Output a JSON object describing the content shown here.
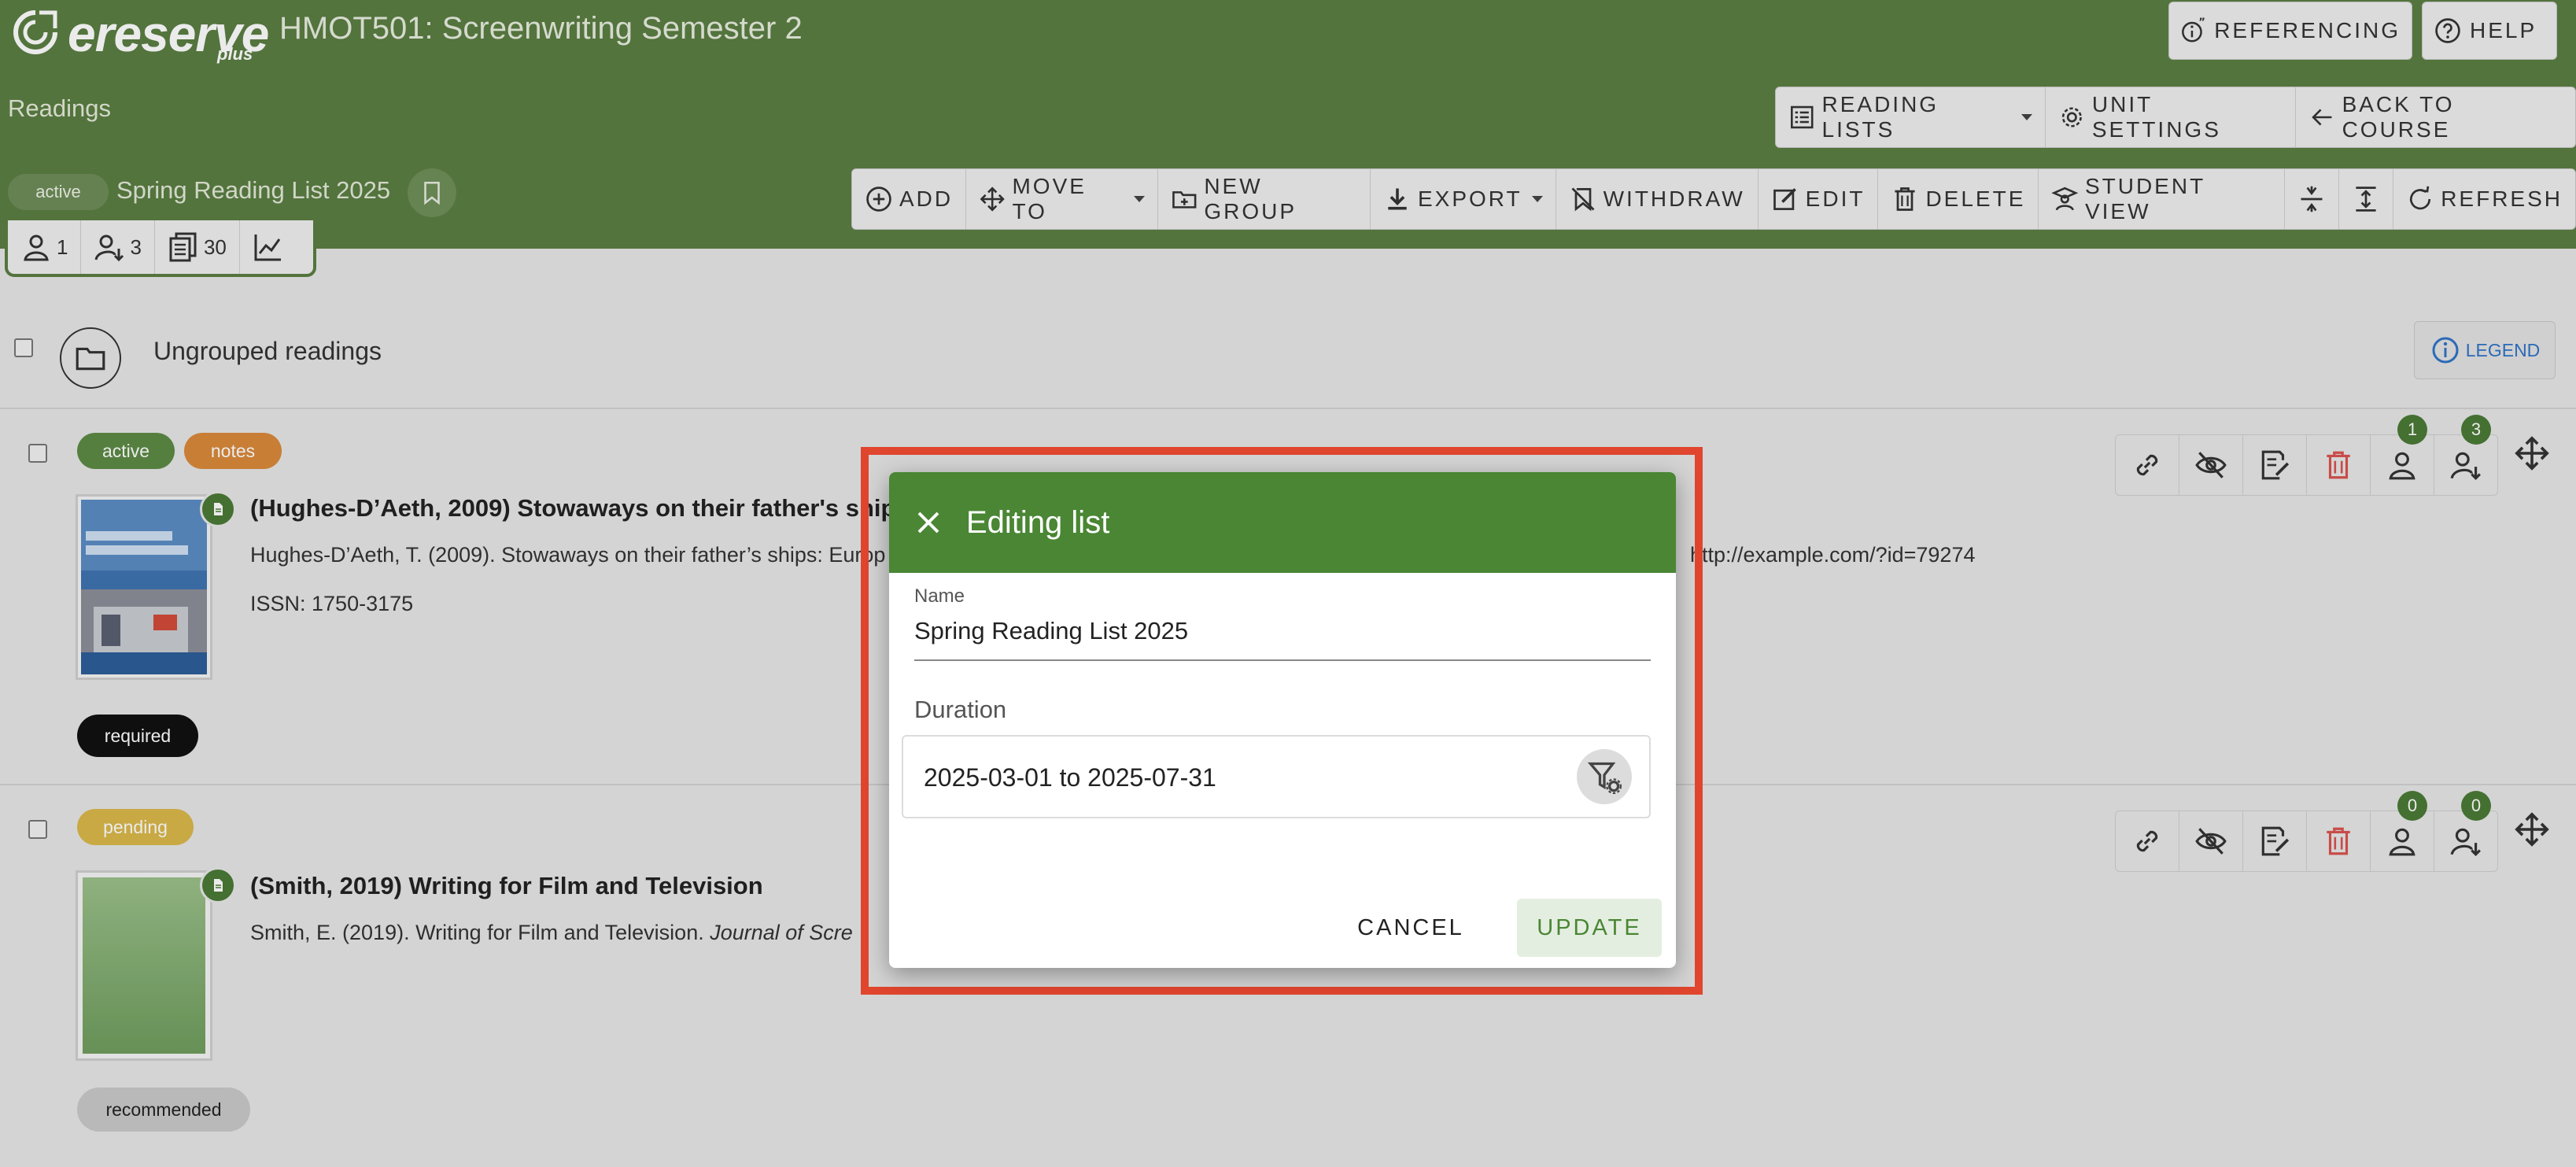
{
  "header": {
    "logo_text": "ereserve",
    "logo_sub": "plus",
    "course_title": "HMOT501: Screenwriting Semester 2",
    "section_label": "Readings",
    "referencing_label": "REFERENCING",
    "help_label": "HELP",
    "reading_lists_label": "READING LISTS",
    "unit_settings_label": "UNIT SETTINGS",
    "back_to_course_label": "BACK TO COURSE"
  },
  "toolbar": {
    "add": "ADD",
    "move_to": "MOVE TO",
    "new_group": "NEW GROUP",
    "export": "EXPORT",
    "withdraw": "WITHDRAW",
    "edit": "EDIT",
    "delete": "DELETE",
    "student_view": "STUDENT VIEW",
    "refresh": "REFRESH"
  },
  "list": {
    "status": "active",
    "name": "Spring Reading List 2025",
    "stats": {
      "users": "1",
      "enrolled": "3",
      "readings": "30"
    }
  },
  "group": {
    "title": "Ungrouped readings",
    "legend_label": "LEGEND"
  },
  "readings": [
    {
      "tags": [
        "active",
        "notes"
      ],
      "title": "(Hughes-D’Aeth, 2009) Stowaways on their father's ships",
      "citation_start": "Hughes-D’Aeth, T. (2009). Stowaways on their father’s ships: Europ",
      "citation_end": "http://example.com/?id=79274",
      "issn": "ISSN: 1750-3175",
      "requirement": "required",
      "count_users": "1",
      "count_enrolled": "3"
    },
    {
      "tags": [
        "pending"
      ],
      "title": "(Smith, 2019) Writing for Film and Television",
      "citation_start": "Smith, E. (2019). Writing for Film and Television. ",
      "citation_italic": "Journal of Scre",
      "requirement": "recommended",
      "count_users": "0",
      "count_enrolled": "0"
    }
  ],
  "dialog": {
    "title": "Editing list",
    "name_label": "Name",
    "name_value": "Spring Reading List 2025",
    "duration_label": "Duration",
    "duration_value": "2025-03-01 to 2025-07-31",
    "cancel_label": "CANCEL",
    "update_label": "UPDATE"
  },
  "colors": {
    "header_green": "#5b7e43",
    "dialog_green": "#4a8634",
    "highlight_red": "#e0452e",
    "tag_active": "#5d8a45",
    "tag_notes": "#d9893a",
    "tag_pending": "#d9b84a",
    "tag_required": "#111111",
    "tag_recommended": "#c9c9c9",
    "delete_red": "#d9534f"
  }
}
